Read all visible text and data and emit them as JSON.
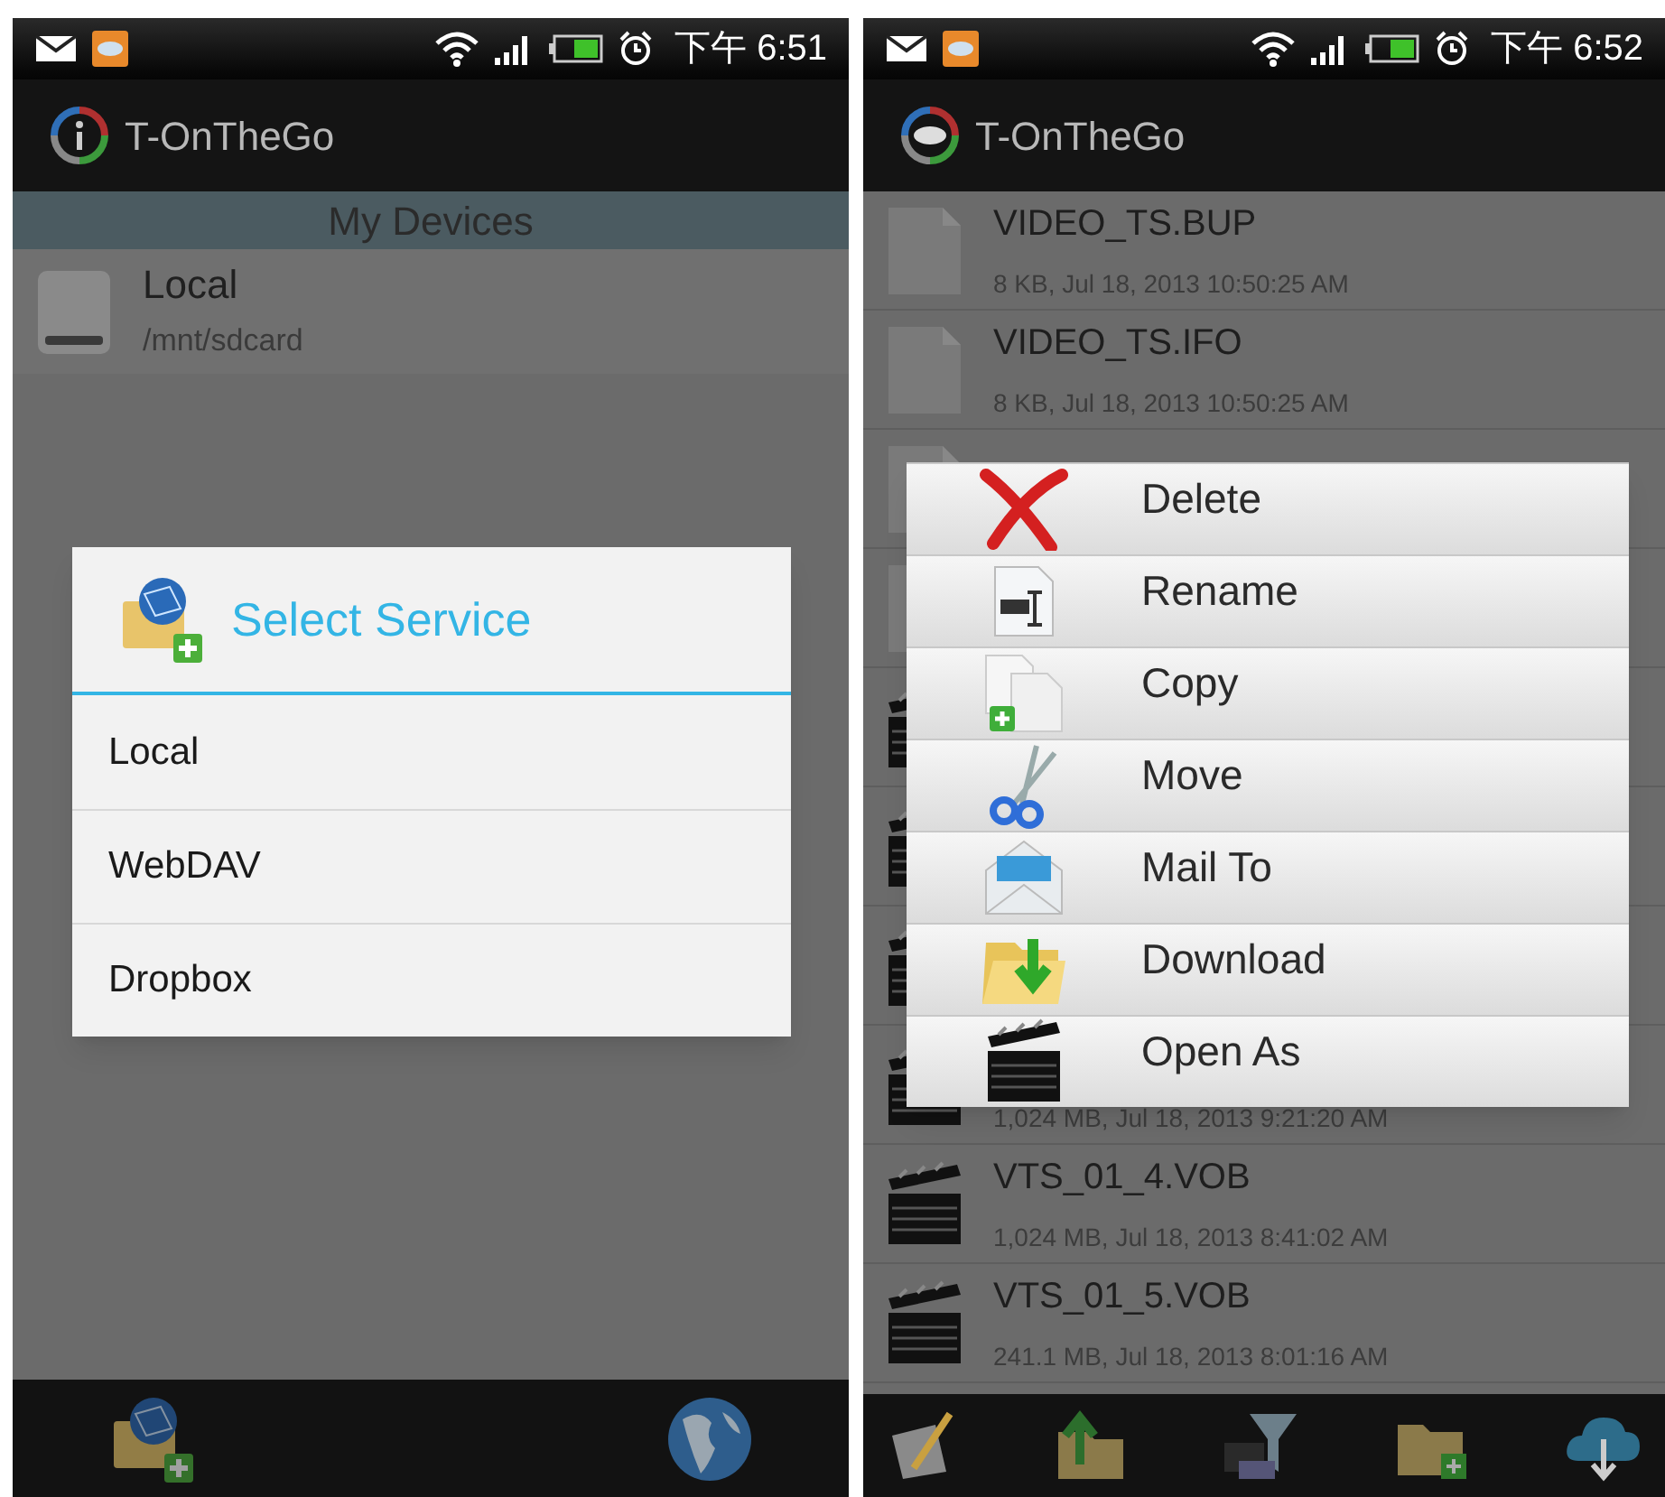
{
  "left_screen": {
    "status_bar": {
      "time": "下午 6:51"
    },
    "app_bar": {
      "title": "T-OnTheGo"
    },
    "section_header": "My Devices",
    "devices": [
      {
        "name": "Local",
        "path": "/mnt/sdcard"
      }
    ],
    "dialog": {
      "title": "Select Service",
      "options": [
        {
          "label": "Local"
        },
        {
          "label": "WebDAV"
        },
        {
          "label": "Dropbox"
        }
      ]
    }
  },
  "right_screen": {
    "status_bar": {
      "time": "下午 6:52"
    },
    "app_bar": {
      "title": "T-OnTheGo"
    },
    "files": [
      {
        "kind": "file",
        "name": "VIDEO_TS.BUP",
        "meta": "8 KB, Jul 18, 2013 10:50:25 AM"
      },
      {
        "kind": "file",
        "name": "VIDEO_TS.IFO",
        "meta": "8 KB, Jul 18, 2013 10:50:25 AM"
      },
      {
        "kind": "file"
      },
      {
        "kind": "file"
      },
      {
        "kind": "video"
      },
      {
        "kind": "video"
      },
      {
        "kind": "video"
      },
      {
        "kind": "video",
        "meta": "1,024 MB, Jul 18, 2013 9:21:20 AM"
      },
      {
        "kind": "video",
        "name": "VTS_01_4.VOB",
        "meta": "1,024 MB, Jul 18, 2013 8:41:02 AM"
      },
      {
        "kind": "video",
        "name": "VTS_01_5.VOB",
        "meta": "241.1 MB, Jul 18, 2013 8:01:16 AM"
      }
    ],
    "context_menu": [
      {
        "label": "Delete"
      },
      {
        "label": "Rename"
      },
      {
        "label": "Copy"
      },
      {
        "label": "Move"
      },
      {
        "label": "Mail To"
      },
      {
        "label": "Download"
      },
      {
        "label": "Open As"
      }
    ]
  }
}
